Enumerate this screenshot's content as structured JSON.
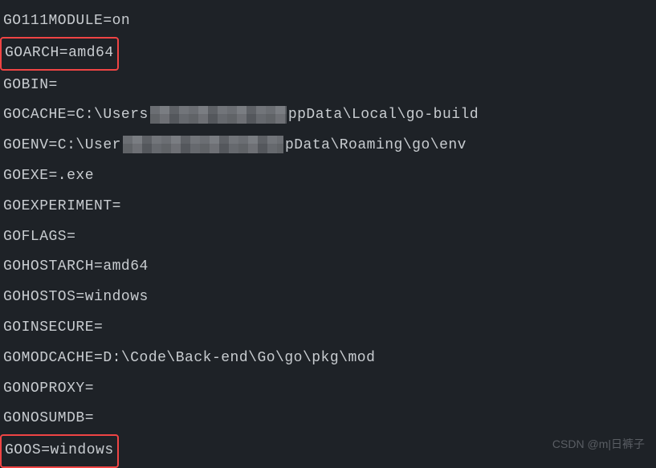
{
  "env_vars": {
    "go111module": "GO111MODULE=on",
    "goarch": "GOARCH=amd64",
    "gobin": "GOBIN=",
    "gocache_prefix": "GOCACHE=C:\\Users",
    "gocache_suffix": "ppData\\Local\\go-build",
    "goenv_prefix": "GOENV=C:\\User",
    "goenv_suffix": "pData\\Roaming\\go\\env",
    "goexe": "GOEXE=.exe",
    "goexperiment": "GOEXPERIMENT=",
    "goflags": "GOFLAGS=",
    "gohostarch": "GOHOSTARCH=amd64",
    "gohostos": "GOHOSTOS=windows",
    "goinsecure": "GOINSECURE=",
    "gomodcache": "GOMODCACHE=D:\\Code\\Back-end\\Go\\go\\pkg\\mod",
    "gonoproxy": "GONOPROXY=",
    "gonosumdb": "GONOSUMDB=",
    "goos": "GOOS=windows"
  },
  "watermark": "CSDN @m|日裤子"
}
